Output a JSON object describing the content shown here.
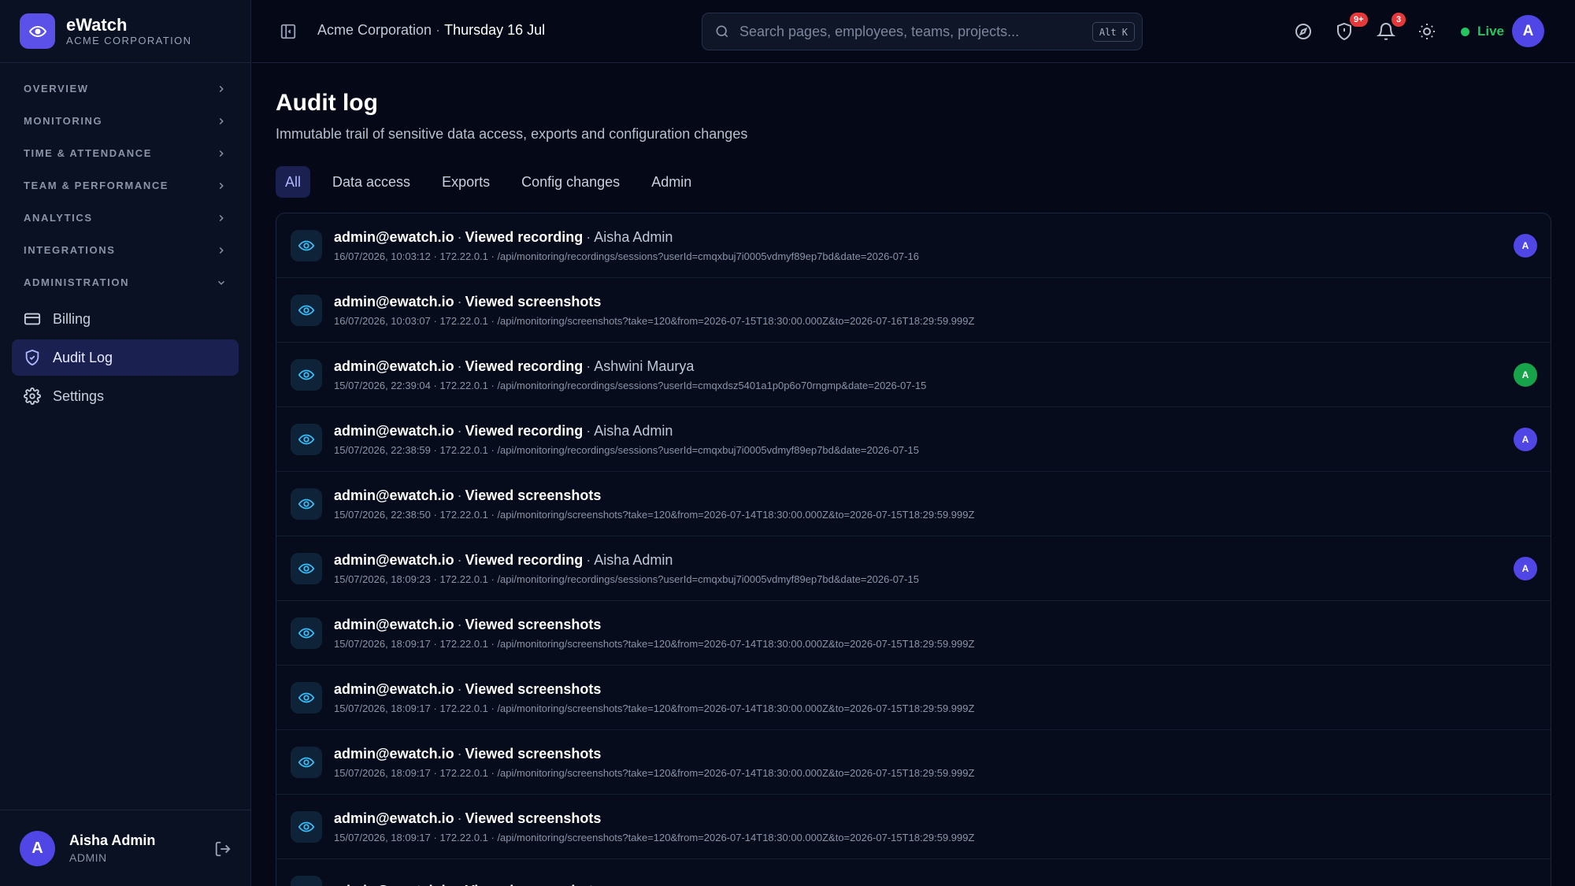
{
  "brand": {
    "name": "eWatch",
    "org": "ACME CORPORATION"
  },
  "sidebar": {
    "sections": [
      {
        "label": "OVERVIEW"
      },
      {
        "label": "MONITORING"
      },
      {
        "label": "TIME & ATTENDANCE"
      },
      {
        "label": "TEAM & PERFORMANCE"
      },
      {
        "label": "ANALYTICS"
      },
      {
        "label": "INTEGRATIONS"
      },
      {
        "label": "ADMINISTRATION"
      }
    ],
    "items": [
      {
        "label": "Billing",
        "icon": "credit-card-icon"
      },
      {
        "label": "Audit Log",
        "icon": "shield-check-icon",
        "active": true
      },
      {
        "label": "Settings",
        "icon": "gear-icon"
      }
    ]
  },
  "user": {
    "name": "Aisha Admin",
    "role": "ADMIN",
    "initial": "A"
  },
  "topbar": {
    "org": "Acme Corporation",
    "separator": "·",
    "date": "Thursday 16 Jul",
    "search_placeholder": "Search pages, employees, teams, projects...",
    "search_shortcut": "Alt K",
    "shield_badge": "9+",
    "bell_badge": "3",
    "live_label": "Live",
    "avatar_initial": "A"
  },
  "colors": {
    "accent": "#4f46e5",
    "live": "#22c55e",
    "badge": "#e5383b",
    "avatar_green": "#16a34a"
  },
  "page": {
    "title": "Audit log",
    "subtitle": "Immutable trail of sensitive data access, exports and configuration changes"
  },
  "tabs": [
    {
      "label": "All",
      "active": true
    },
    {
      "label": "Data access"
    },
    {
      "label": "Exports"
    },
    {
      "label": "Config changes"
    },
    {
      "label": "Admin"
    }
  ],
  "rows": [
    {
      "actor": "admin@ewatch.io",
      "action": "Viewed recording",
      "target": "Aisha Admin",
      "meta": "16/07/2026, 10:03:12 · 172.22.0.1 · /api/monitoring/recordings/sessions?userId=cmqxbuj7i0005vdmyf89ep7bd&date=2026-07-16",
      "avatar": "A",
      "avatar_color": "#4f46e5"
    },
    {
      "actor": "admin@ewatch.io",
      "action": "Viewed screenshots",
      "target": "",
      "meta": "16/07/2026, 10:03:07 · 172.22.0.1 · /api/monitoring/screenshots?take=120&from=2026-07-15T18:30:00.000Z&to=2026-07-16T18:29:59.999Z",
      "avatar": "",
      "avatar_color": ""
    },
    {
      "actor": "admin@ewatch.io",
      "action": "Viewed recording",
      "target": "Ashwini Maurya",
      "meta": "15/07/2026, 22:39:04 · 172.22.0.1 · /api/monitoring/recordings/sessions?userId=cmqxdsz5401a1p0p6o70rngmp&date=2026-07-15",
      "avatar": "A",
      "avatar_color": "#16a34a"
    },
    {
      "actor": "admin@ewatch.io",
      "action": "Viewed recording",
      "target": "Aisha Admin",
      "meta": "15/07/2026, 22:38:59 · 172.22.0.1 · /api/monitoring/recordings/sessions?userId=cmqxbuj7i0005vdmyf89ep7bd&date=2026-07-15",
      "avatar": "A",
      "avatar_color": "#4f46e5"
    },
    {
      "actor": "admin@ewatch.io",
      "action": "Viewed screenshots",
      "target": "",
      "meta": "15/07/2026, 22:38:50 · 172.22.0.1 · /api/monitoring/screenshots?take=120&from=2026-07-14T18:30:00.000Z&to=2026-07-15T18:29:59.999Z",
      "avatar": "",
      "avatar_color": ""
    },
    {
      "actor": "admin@ewatch.io",
      "action": "Viewed recording",
      "target": "Aisha Admin",
      "meta": "15/07/2026, 18:09:23 · 172.22.0.1 · /api/monitoring/recordings/sessions?userId=cmqxbuj7i0005vdmyf89ep7bd&date=2026-07-15",
      "avatar": "A",
      "avatar_color": "#4f46e5"
    },
    {
      "actor": "admin@ewatch.io",
      "action": "Viewed screenshots",
      "target": "",
      "meta": "15/07/2026, 18:09:17 · 172.22.0.1 · /api/monitoring/screenshots?take=120&from=2026-07-14T18:30:00.000Z&to=2026-07-15T18:29:59.999Z",
      "avatar": "",
      "avatar_color": ""
    },
    {
      "actor": "admin@ewatch.io",
      "action": "Viewed screenshots",
      "target": "",
      "meta": "15/07/2026, 18:09:17 · 172.22.0.1 · /api/monitoring/screenshots?take=120&from=2026-07-14T18:30:00.000Z&to=2026-07-15T18:29:59.999Z",
      "avatar": "",
      "avatar_color": ""
    },
    {
      "actor": "admin@ewatch.io",
      "action": "Viewed screenshots",
      "target": "",
      "meta": "15/07/2026, 18:09:17 · 172.22.0.1 · /api/monitoring/screenshots?take=120&from=2026-07-14T18:30:00.000Z&to=2026-07-15T18:29:59.999Z",
      "avatar": "",
      "avatar_color": ""
    },
    {
      "actor": "admin@ewatch.io",
      "action": "Viewed screenshots",
      "target": "",
      "meta": "15/07/2026, 18:09:17 · 172.22.0.1 · /api/monitoring/screenshots?take=120&from=2026-07-14T18:30:00.000Z&to=2026-07-15T18:29:59.999Z",
      "avatar": "",
      "avatar_color": ""
    },
    {
      "actor": "admin@ewatch.io",
      "action": "Viewed screenshots",
      "target": "",
      "meta": "",
      "avatar": "",
      "avatar_color": ""
    }
  ]
}
